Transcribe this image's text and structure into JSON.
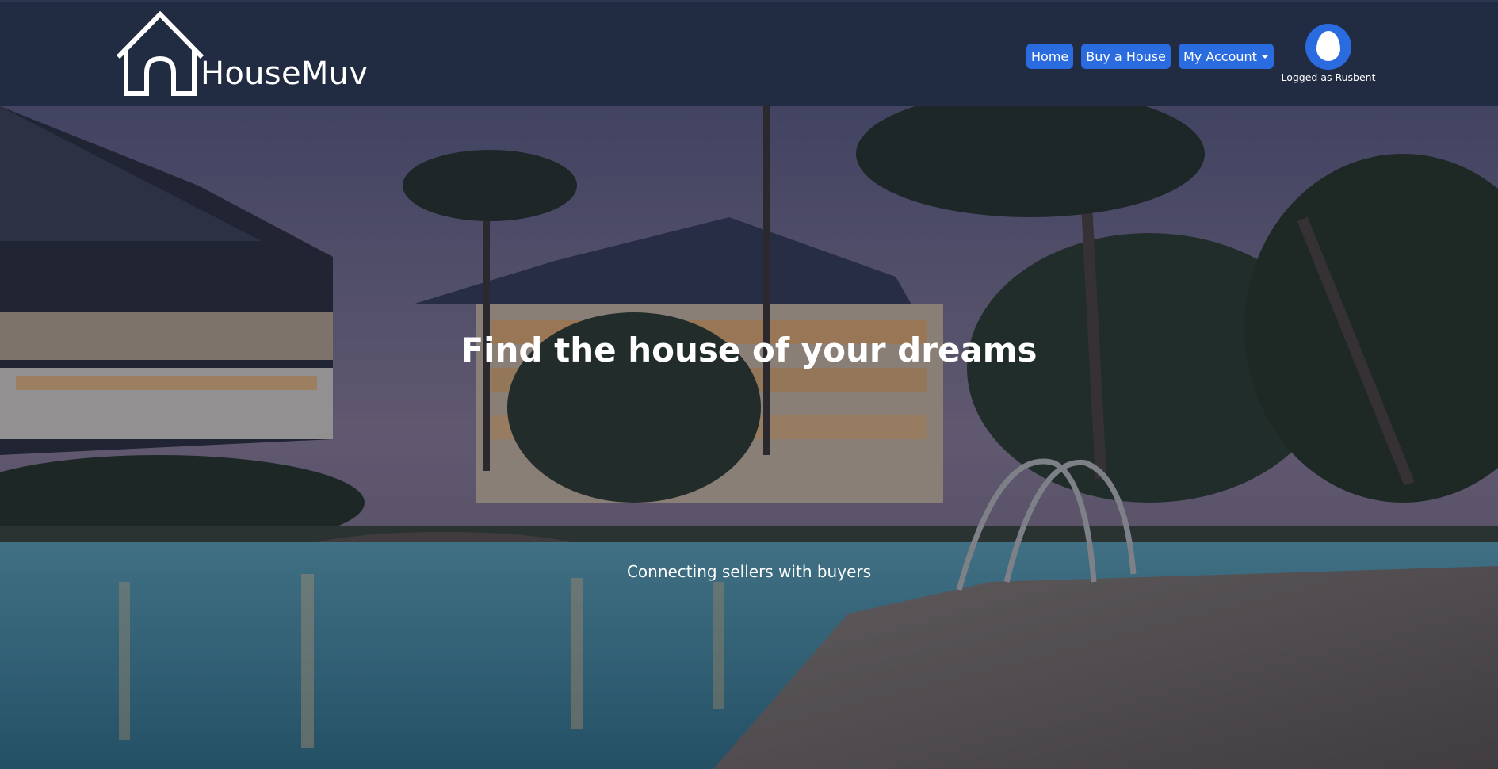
{
  "brand": {
    "name": "HouseMuv",
    "icon": "house-outline-icon"
  },
  "nav": {
    "home_label": "Home",
    "buy_label": "Buy a House",
    "account_label": "My Account",
    "account_icon": "caret-down-icon"
  },
  "account": {
    "avatar_icon": "egg-avatar-icon",
    "logged_as": "Logged as Rusbent"
  },
  "hero": {
    "title": "Find the house of your dreams",
    "subtitle": "Connecting sellers with buyers",
    "background": "resort-pool-at-dusk-photo"
  },
  "colors": {
    "navbar": "#212c43",
    "accent": "#2a6be0",
    "text": "#ffffff"
  }
}
